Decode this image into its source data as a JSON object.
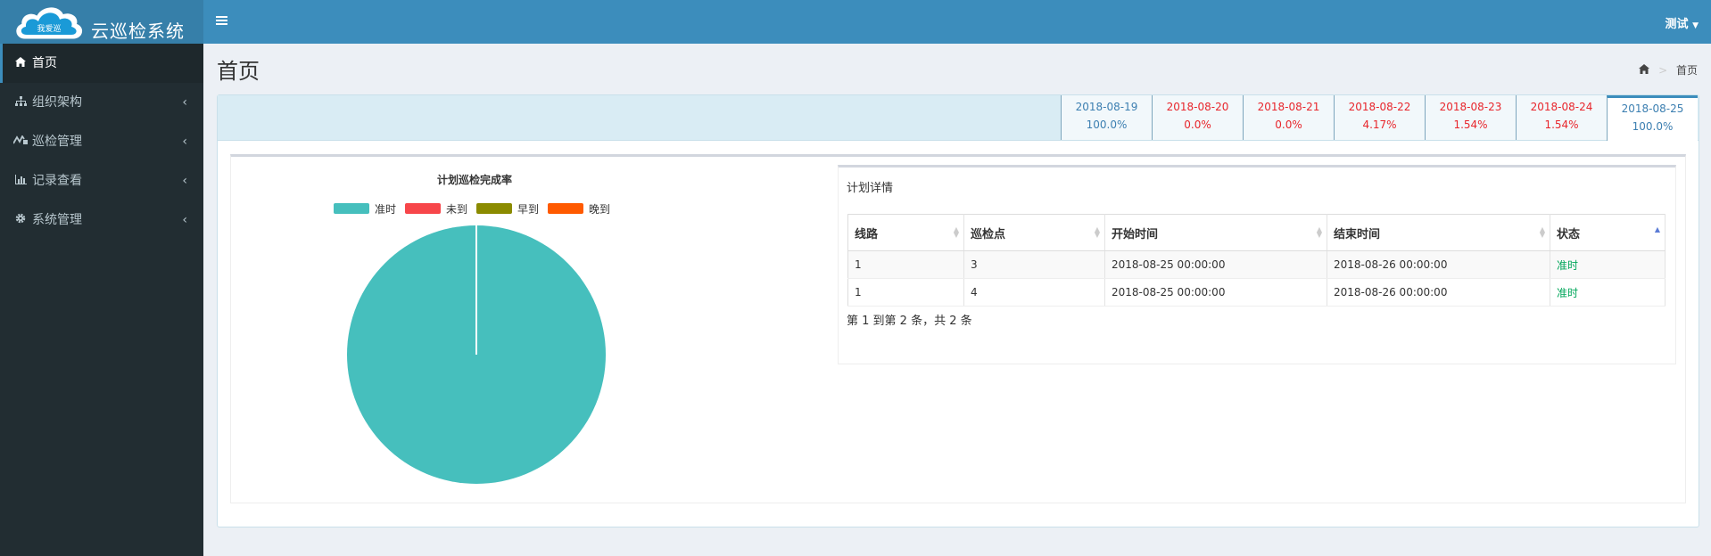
{
  "app": {
    "logo_text": "我爱巡",
    "title": "云巡检系统"
  },
  "sidebar": {
    "items": [
      {
        "label": "首页",
        "icon": "home-icon"
      },
      {
        "label": "组织架构",
        "icon": "sitemap-icon"
      },
      {
        "label": "巡检管理",
        "icon": "tasks-icon"
      },
      {
        "label": "记录查看",
        "icon": "bar-chart-icon"
      },
      {
        "label": "系统管理",
        "icon": "gear-icon"
      }
    ]
  },
  "header": {
    "toggle_icon": "menu-icon",
    "user": "测试"
  },
  "page": {
    "title": "首页",
    "breadcrumb": "首页"
  },
  "dates": [
    {
      "date": "2018-08-19",
      "rate": "100.0%",
      "color": "#3c7fb1"
    },
    {
      "date": "2018-08-20",
      "rate": "0.0%",
      "color": "#e8262c"
    },
    {
      "date": "2018-08-21",
      "rate": "0.0%",
      "color": "#e8262c"
    },
    {
      "date": "2018-08-22",
      "rate": "4.17%",
      "color": "#e8262c"
    },
    {
      "date": "2018-08-23",
      "rate": "1.54%",
      "color": "#e8262c"
    },
    {
      "date": "2018-08-24",
      "rate": "1.54%",
      "color": "#e8262c"
    },
    {
      "date": "2018-08-25",
      "rate": "100.0%",
      "color": "#3c7fb1"
    }
  ],
  "chart_data": {
    "type": "pie",
    "title": "计划巡检完成率",
    "legend_position": "top",
    "categories": [
      "准时",
      "未到",
      "早到",
      "晚到"
    ],
    "values": [
      2,
      0,
      0,
      0
    ],
    "colors": [
      "#46bfbd",
      "#f7464a",
      "#8b8b00",
      "#ff5a00"
    ]
  },
  "detail": {
    "title": "计划详情",
    "columns": [
      "线路",
      "巡检点",
      "开始时间",
      "结束时间",
      "状态"
    ],
    "rows": [
      [
        "1",
        "3",
        "2018-08-25 00:00:00",
        "2018-08-26 00:00:00",
        "准时"
      ],
      [
        "1",
        "4",
        "2018-08-25 00:00:00",
        "2018-08-26 00:00:00",
        "准时"
      ]
    ],
    "pagination": "第 1 到第 2 条，共 2 条"
  }
}
